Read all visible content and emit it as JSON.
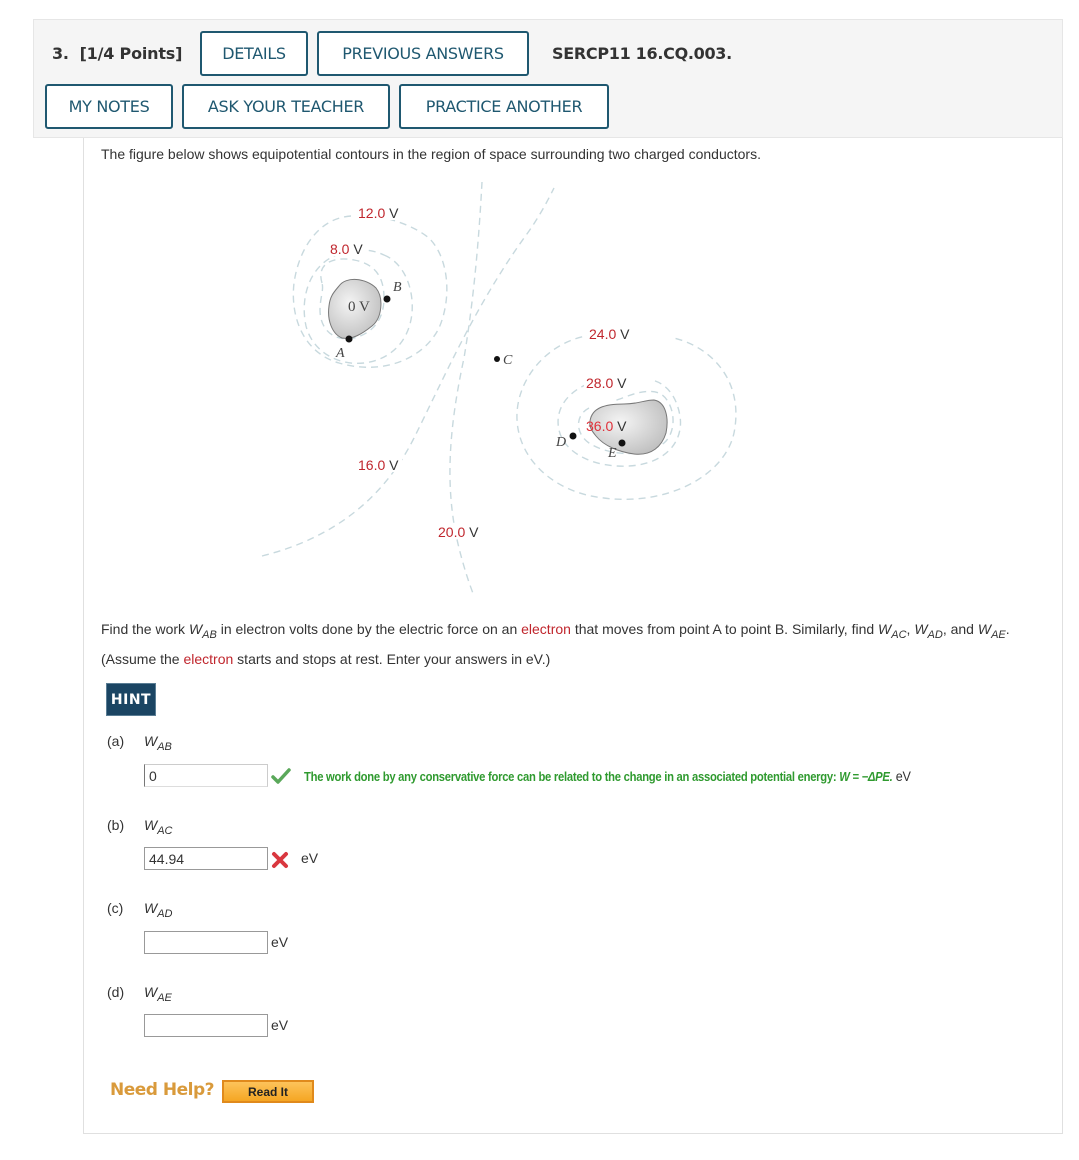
{
  "header": {
    "question_number": "3.",
    "points": "[1/4 Points]",
    "details_label": "DETAILS",
    "previous_answers_label": "PREVIOUS ANSWERS",
    "question_code": "SERCP11 16.CQ.003.",
    "my_notes_label": "MY NOTES",
    "ask_teacher_label": "ASK YOUR TEACHER",
    "practice_another_label": "PRACTICE ANOTHER"
  },
  "intro": "The figure below shows equipotential contours in the region of space surrounding two charged conductors.",
  "figure": {
    "contour_labels": {
      "v12": {
        "num": "12.0",
        "unit": " V"
      },
      "v8": {
        "num": "8.0",
        "unit": " V"
      },
      "v16": {
        "num": "16.0",
        "unit": " V"
      },
      "v20": {
        "num": "20.0",
        "unit": " V"
      },
      "v24": {
        "num": "24.0",
        "unit": " V"
      },
      "v28": {
        "num": "28.0",
        "unit": " V"
      },
      "v36": {
        "num": "36.0",
        "unit": " V"
      }
    },
    "left_conductor_label": "0 V",
    "points": {
      "A": "A",
      "B": "B",
      "C": "C",
      "D": "D",
      "E": "E"
    },
    "colors": {
      "contour": "#c8d9de",
      "label_number": "#c0262d",
      "conductor": "#cccccc"
    }
  },
  "problem": {
    "p1": "Find the work ",
    "w": "W",
    "ab": "AB",
    "p2": " in electron volts done by the electric force on an ",
    "electron": "electron",
    "p3": " that moves from point A to point B. Similarly, find ",
    "ac": "AC",
    "ad": "AD",
    "ae": "AE",
    "comma": ", ",
    "and": ", and ",
    "period": ".",
    "p4": "(Assume the ",
    "p5": " starts and stops at rest. Enter your answers in eV.)"
  },
  "hint_label": "HINT",
  "parts": [
    {
      "label": "(a)",
      "var": "W",
      "sub": "AB",
      "value": "0",
      "status": "correct",
      "unit": "eV"
    },
    {
      "label": "(b)",
      "var": "W",
      "sub": "AC",
      "value": "44.94",
      "status": "incorrect",
      "unit": "eV"
    },
    {
      "label": "(c)",
      "var": "W",
      "sub": "AD",
      "value": "",
      "status": "unanswered",
      "unit": "eV"
    },
    {
      "label": "(d)",
      "var": "W",
      "sub": "AE",
      "value": "",
      "status": "unanswered",
      "unit": "eV"
    }
  ],
  "feedback": {
    "text": "The work done by any conservative force can be related to the change in an associated potential energy: ",
    "formula": "W = −ΔPE.",
    "unit": " eV"
  },
  "help": {
    "need_help_label": "Need Help?",
    "read_it_label": "Read It"
  },
  "colors": {
    "accent": "#1f5870",
    "hint_bg": "#1b4563",
    "correct": "#2f9a2f",
    "incorrect": "#d9373f",
    "need_help": "#d99a3b",
    "read_it_bg": "#f5a623"
  }
}
